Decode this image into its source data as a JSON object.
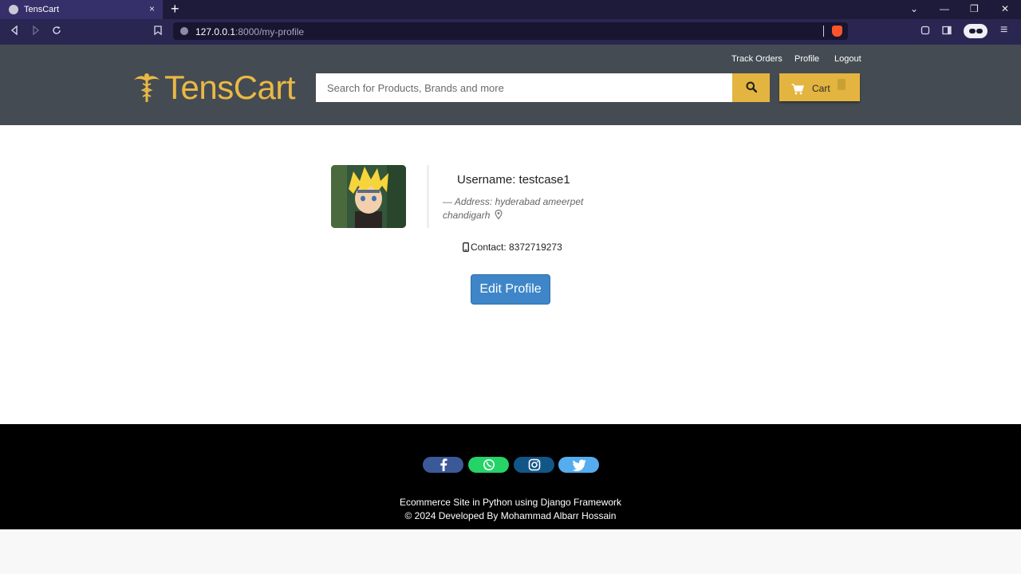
{
  "browser": {
    "tab_title": "TensCart",
    "tab_close": "×",
    "new_tab": "+",
    "url_host": "127.0.0.1",
    "url_path": ":8000/my-profile",
    "controls": {
      "dropdown": "⌄",
      "minimize": "—",
      "maximize": "❐",
      "close": "✕"
    },
    "menu_icon": "≡"
  },
  "header": {
    "links": [
      "Track Orders",
      "Profile",
      "Logout"
    ],
    "logo_text": "TensCart",
    "search": {
      "placeholder": "Search for Products, Brands and more",
      "value": ""
    },
    "cart_label": "Cart",
    "colors": {
      "bar": "#454b52",
      "accent": "#e3b43f",
      "logo": "#e9b944"
    }
  },
  "profile": {
    "username": "Username: testcase1",
    "address": "— Address: hyderabad ameerpet chandigarh",
    "contact": "Contact: 8372719273",
    "edit_label": "Edit Profile"
  },
  "footer": {
    "socials": [
      "facebook-icon",
      "whatsapp-icon",
      "instagram-icon",
      "twitter-icon"
    ],
    "line1": "Ecommerce Site in Python using Django Framework",
    "line2": "© 2024 Developed By Mohammad Albarr Hossain"
  }
}
